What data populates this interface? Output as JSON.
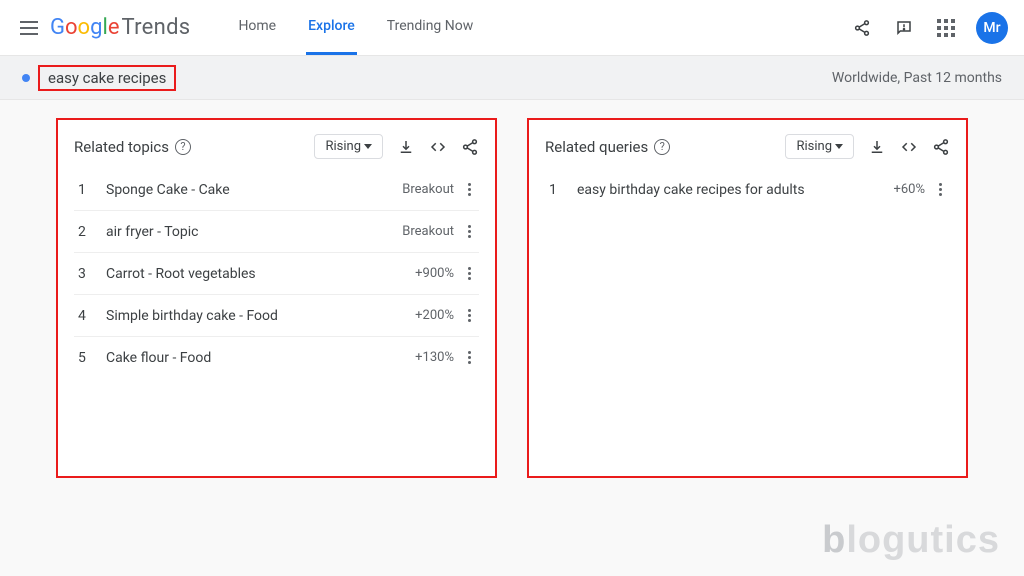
{
  "header": {
    "logo": {
      "google": "Google",
      "trends": "Trends"
    },
    "nav": {
      "home": "Home",
      "explore": "Explore",
      "trending": "Trending Now"
    },
    "avatar_initials": "Mr"
  },
  "sub_header": {
    "search_term": "easy cake recipes",
    "context": "Worldwide, Past 12 months"
  },
  "related_topics": {
    "title": "Related topics",
    "sort": "Rising",
    "rows": [
      {
        "rank": "1",
        "label": "Sponge Cake - Cake",
        "value": "Breakout"
      },
      {
        "rank": "2",
        "label": "air fryer - Topic",
        "value": "Breakout"
      },
      {
        "rank": "3",
        "label": "Carrot - Root vegetables",
        "value": "+900%"
      },
      {
        "rank": "4",
        "label": "Simple birthday cake - Food",
        "value": "+200%"
      },
      {
        "rank": "5",
        "label": "Cake flour - Food",
        "value": "+130%"
      }
    ]
  },
  "related_queries": {
    "title": "Related queries",
    "sort": "Rising",
    "rows": [
      {
        "rank": "1",
        "label": "easy birthday cake recipes for adults",
        "value": "+60%"
      }
    ]
  },
  "watermark": "blogutics"
}
